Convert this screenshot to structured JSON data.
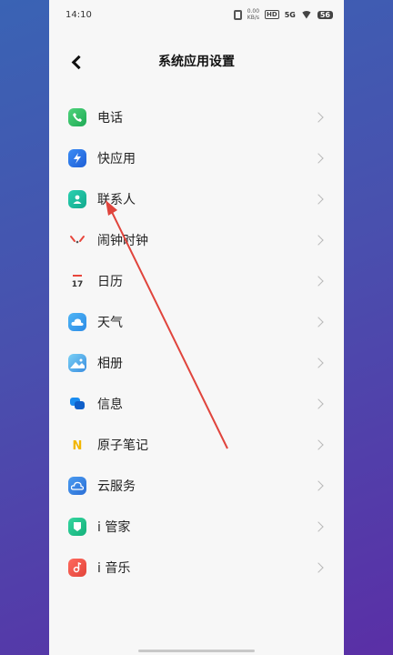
{
  "status": {
    "time": "14:10",
    "net_speed_top": "0.00",
    "net_speed_bottom": "KB/s",
    "hd": "HD",
    "network": "5G",
    "battery": "56"
  },
  "header": {
    "title": "系统应用设置"
  },
  "items": [
    {
      "label": "电话",
      "icon": "phone-icon"
    },
    {
      "label": "快应用",
      "icon": "quick-app-icon"
    },
    {
      "label": "联系人",
      "icon": "contacts-icon"
    },
    {
      "label": "闹钟时钟",
      "icon": "alarm-clock-icon"
    },
    {
      "label": "日历",
      "icon": "calendar-icon",
      "icon_text": "17"
    },
    {
      "label": "天气",
      "icon": "weather-icon"
    },
    {
      "label": "相册",
      "icon": "album-icon"
    },
    {
      "label": "信息",
      "icon": "messages-icon"
    },
    {
      "label": "原子笔记",
      "icon": "notes-icon",
      "icon_text": "N"
    },
    {
      "label": "云服务",
      "icon": "cloud-service-icon"
    },
    {
      "label": "i 管家",
      "icon": "i-manager-icon"
    },
    {
      "label": "i 音乐",
      "icon": "i-music-icon"
    }
  ],
  "colors": {
    "arrow": "#e0443c",
    "accent_bg_top": "#3a63b4",
    "accent_bg_bottom": "#5a2fa6"
  }
}
